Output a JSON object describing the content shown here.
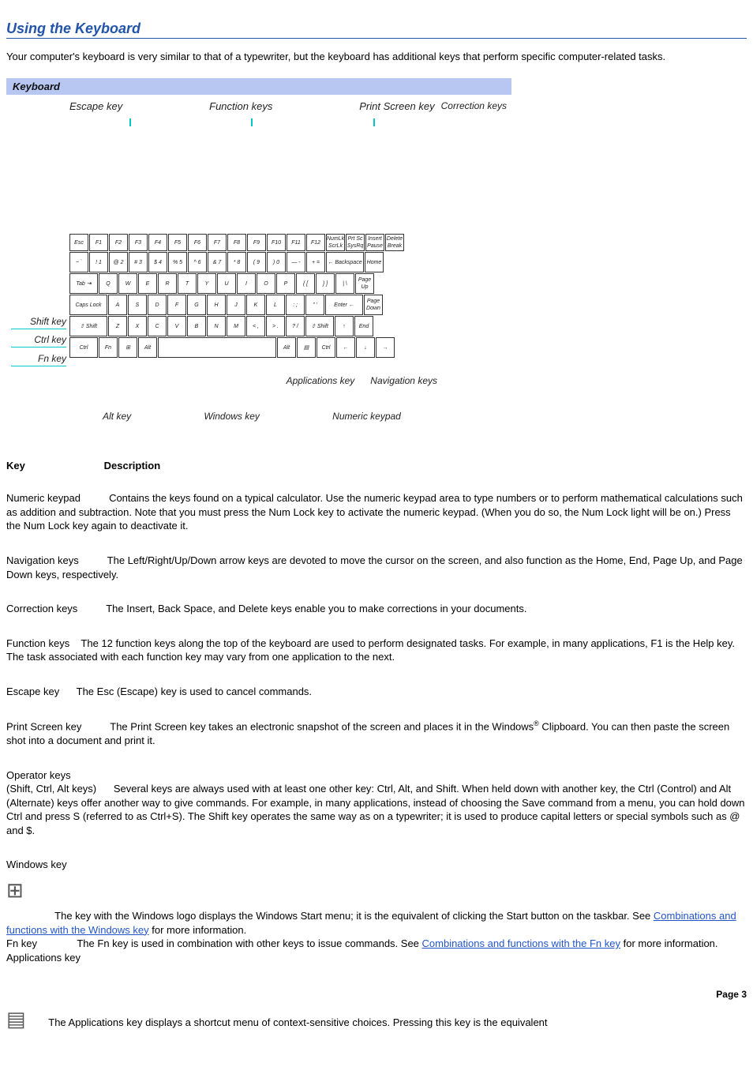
{
  "title": "Using the Keyboard",
  "intro": "Your computer's keyboard is very similar to that of a typewriter, but the keyboard has additional keys that perform specific computer-related tasks.",
  "figure": {
    "title": "Keyboard",
    "labels": {
      "escape": "Escape key",
      "function": "Function keys",
      "print": "Print Screen key",
      "correction": "Correction keys",
      "shift": "Shift key",
      "ctrl": "Ctrl key",
      "fn": "Fn key",
      "alt": "Alt key",
      "windows": "Windows key",
      "numeric": "Numeric keypad",
      "apps": "Applications key",
      "nav": "Navigation keys"
    },
    "keys": {
      "row1": [
        "Esc",
        "F1",
        "F2",
        "F3",
        "F4",
        "F5",
        "F6",
        "F7",
        "F8",
        "F9",
        "F10",
        "F11",
        "F12",
        "NumLk ScrLk",
        "Prt Sc SysRq",
        "Insert Pause",
        "Delete Break"
      ],
      "row2": [
        "~ `",
        "! 1",
        "@ 2",
        "# 3",
        "$ 4",
        "% 5",
        "^ 6",
        "& 7",
        "* 8",
        "( 9",
        ") 0",
        "— -",
        "+ =",
        "← Backspace",
        "Home"
      ],
      "row3": [
        "Tab ⇥",
        "Q",
        "W",
        "E",
        "R",
        "T",
        "Y",
        "U",
        "I",
        "O",
        "P",
        "{ [",
        "} ]",
        "| \\",
        "Page Up"
      ],
      "row4": [
        "Caps Lock",
        "A",
        "S",
        "D",
        "F",
        "G",
        "H",
        "J",
        "K",
        "L",
        ": ;",
        "\" '",
        "Enter ←",
        "Page Down"
      ],
      "row5": [
        "⇧ Shift",
        "Z",
        "X",
        "C",
        "V",
        "B",
        "N",
        "M",
        "< ,",
        "> .",
        "? /",
        "⇧ Shift",
        "↑",
        "End"
      ],
      "row6": [
        "Ctrl",
        "Fn",
        "⊞",
        "Alt",
        "",
        "Alt",
        "▤",
        "Ctrl",
        "←",
        "↓",
        "→"
      ]
    }
  },
  "tableHeader": {
    "key": "Key",
    "desc": "Description"
  },
  "entries": {
    "numeric": {
      "key": "Numeric keypad",
      "desc": "Contains the keys found on a typical calculator. Use the numeric keypad area to type numbers or to perform mathematical calculations such as addition and subtraction. Note that you must press the Num Lock key to activate the numeric keypad. (When you do so, the Num Lock light will be on.) Press the Num Lock key again to deactivate it."
    },
    "nav": {
      "key": "Navigation keys",
      "desc": "The Left/Right/Up/Down arrow keys are devoted to move the cursor on the screen, and also function as the Home, End, Page Up, and Page Down keys, respectively."
    },
    "correction": {
      "key": "Correction keys",
      "desc": "The Insert, Back Space, and Delete keys enable you to make corrections in your documents."
    },
    "function": {
      "key": "Function keys",
      "desc": "The 12 function keys along the top of the keyboard are used to perform designated tasks. For example, in many applications, F1 is the Help key. The task associated with each function key may vary from one application to the next."
    },
    "escape": {
      "key": "Escape key",
      "desc": "The Esc (Escape) key is used to cancel commands."
    },
    "print": {
      "key": "Print Screen key",
      "desc_a": "The Print Screen key takes an electronic snapshot of the screen and places it in the Windows",
      "desc_b": " Clipboard. You can then paste the screen shot into a document and print it."
    },
    "operator": {
      "key": "Operator keys",
      "sub": "(Shift, Ctrl, Alt keys)",
      "desc": "Several keys are always used with at least one other key: Ctrl, Alt, and Shift. When held down with another key, the Ctrl (Control) and Alt (Alternate) keys offer another way to give commands. For example, in many applications, instead of choosing the Save command from a menu, you can hold down Ctrl and press S (referred to as Ctrl+S). The Shift key operates the same way as on a typewriter; it is used to produce capital letters or special symbols such as @ and $."
    },
    "windows": {
      "key": "Windows key",
      "desc_a": "The key with the Windows logo displays the Windows Start menu; it is the equivalent of clicking the Start button on the taskbar. See ",
      "link": "Combinations and functions with the Windows key",
      "desc_b": " for more information."
    },
    "fn": {
      "key": "Fn key",
      "desc_a": "The Fn key is used in combination with other keys to issue commands. See ",
      "link": "Combinations and functions with the Fn key",
      "desc_b": " for more information."
    },
    "apps": {
      "key": "Applications key",
      "desc": "The Applications key displays a shortcut menu of context-sensitive choices. Pressing this key is the equivalent"
    }
  },
  "pageNum": "Page 3"
}
